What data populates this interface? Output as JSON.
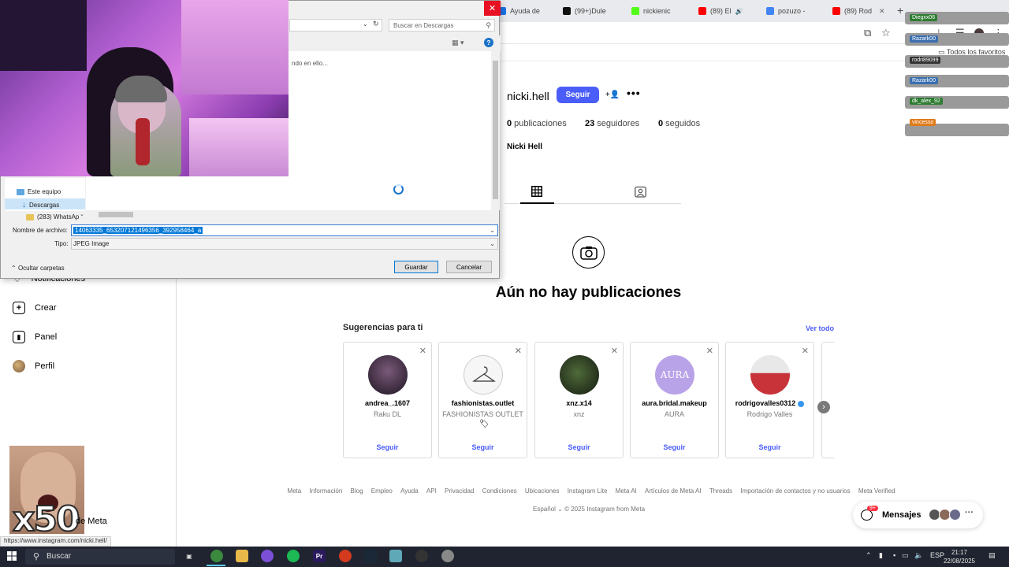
{
  "browser": {
    "tabs": [
      {
        "label": "Ayuda de",
        "favicon_color": "#1a73e8"
      },
      {
        "label": "(99+)Dule",
        "favicon_color": "#111111"
      },
      {
        "label": "nickienic",
        "favicon_color": "#53fc18"
      },
      {
        "label": "(89) El",
        "favicon_color": "#ff0000"
      },
      {
        "label": "pozuzo -",
        "favicon_color": "#4285f4"
      },
      {
        "label": "(89) Rod",
        "favicon_color": "#ff0000"
      }
    ],
    "new_tab": "+",
    "bookmarks_all": "Todos los favoritos",
    "status_url": "https://www.instagram.com/nicki.hell/"
  },
  "profile": {
    "username": "nicki.hell",
    "follow_label": "Seguir",
    "more_label": "•••",
    "posts_count": "0",
    "posts_label": "publicaciones",
    "followers_count": "23",
    "followers_label": "seguidores",
    "following_count": "0",
    "following_label": "seguidos",
    "full_name": "Nicki Hell",
    "empty_title": "Aún no hay publicaciones"
  },
  "sidebar": {
    "items": [
      {
        "label": "Notificaciones"
      },
      {
        "label": "Crear"
      },
      {
        "label": "Panel"
      },
      {
        "label": "Perfil"
      }
    ],
    "meta_label": "de Meta"
  },
  "suggestions": {
    "title": "Sugerencias para ti",
    "see_all": "Ver todo",
    "close": "✕",
    "follow_label": "Seguir",
    "cards": [
      {
        "username": "andrea_.1607",
        "subtitle": "Raku DL",
        "pic_color": "#3a2a3a"
      },
      {
        "username": "fashionistas.outlet",
        "subtitle": "FASHIONISTAS OUTLET",
        "pic_color": "#f4f4f4"
      },
      {
        "username": "xnz.x14",
        "subtitle": "xnz",
        "pic_color": "#1e2a18"
      },
      {
        "username": "aura.bridal.makeup",
        "subtitle": "AURA",
        "pic_color": "#b9a3e8"
      },
      {
        "username": "rodrigovalles0312",
        "subtitle": "Rodrigo Valles",
        "pic_color": "#c8333a"
      }
    ]
  },
  "footer": {
    "links": [
      "Meta",
      "Información",
      "Blog",
      "Empleo",
      "Ayuda",
      "API",
      "Privacidad",
      "Condiciones",
      "Ubicaciones",
      "Instagram Lite",
      "Meta AI",
      "Artículos de Meta AI",
      "Threads",
      "Importación de contactos y no usuarios",
      "Meta Verified"
    ],
    "language": "Español",
    "copyright": "© 2025 Instagram from Meta"
  },
  "messages": {
    "label": "Mensajes",
    "badge": "9+",
    "more": "···"
  },
  "dialog": {
    "search_placeholder": "Buscar en Descargas",
    "working_text": "ndo en ello...",
    "tree_items": [
      "Este equipo",
      "Descargas",
      "(283) WhatsAp"
    ],
    "filename_label": "Nombre de archivo:",
    "filename_value": "14063335_653207121496356_392958464_a",
    "type_label": "Tipo:",
    "type_value": "JPEG Image",
    "hide_folders": "Ocultar carpetas",
    "save_label": "Guardar",
    "cancel_label": "Cancelar",
    "close": "✕",
    "help": "?"
  },
  "overlay": {
    "reaction_text": "x50",
    "chat_names": [
      {
        "name": "Diegxx06",
        "color": "#2e7d32"
      },
      {
        "name": "Razark00",
        "color": "#3a6fb0"
      },
      {
        "name": "rodri89099",
        "color": "#333333"
      },
      {
        "name": "Razark00",
        "color": "#3a6fb0"
      },
      {
        "name": "dk_alex_92",
        "color": "#2e7d32"
      },
      {
        "name": "vincesso",
        "color": "#e07b1a"
      }
    ]
  },
  "taskbar": {
    "search_label": "Buscar",
    "language": "ESP",
    "time": "21:17",
    "date": "22/08/2025"
  }
}
